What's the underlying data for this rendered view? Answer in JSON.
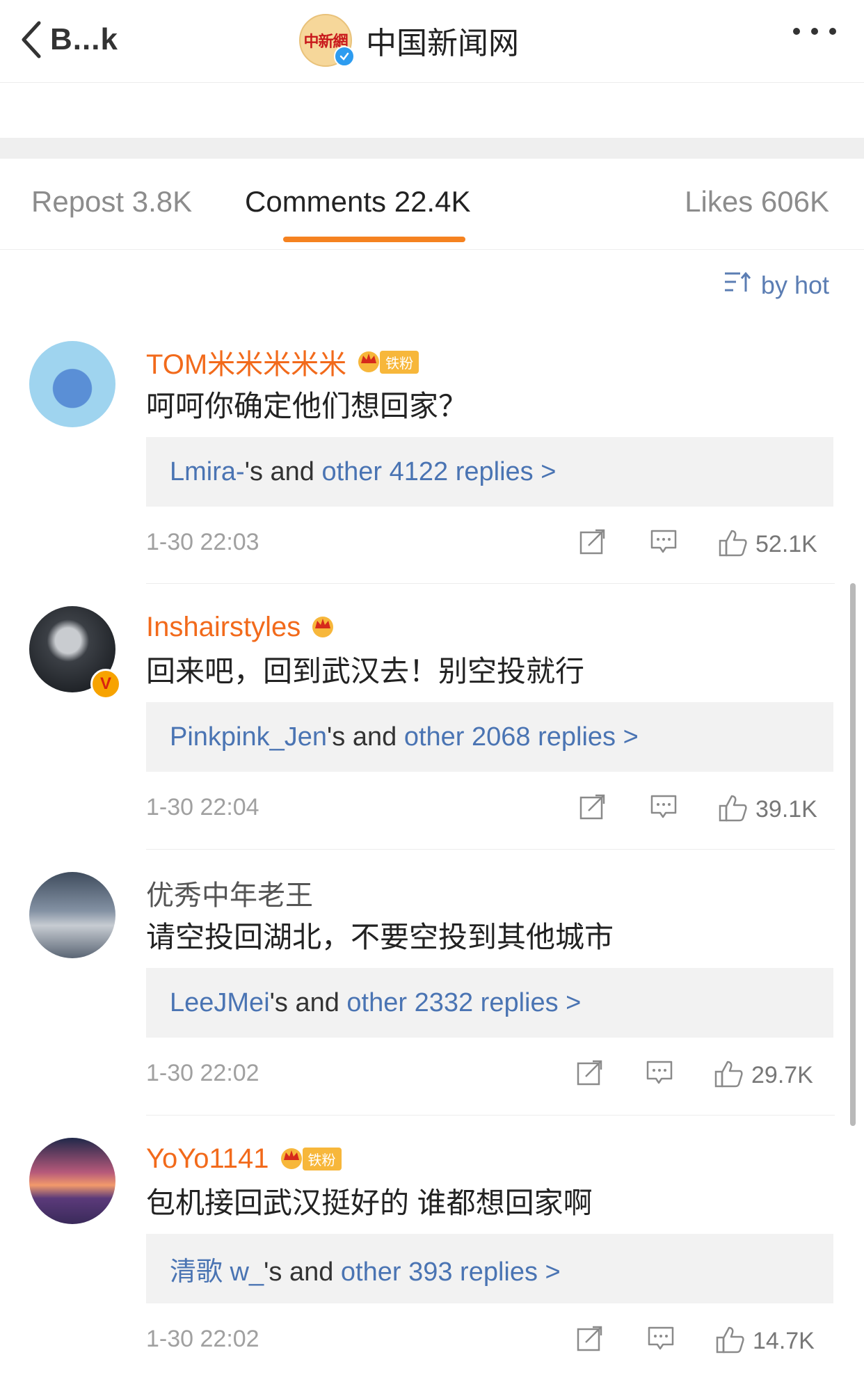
{
  "header": {
    "back_label": "B...k",
    "logo_text": "中新網",
    "title": "中国新闻网"
  },
  "tabs": [
    {
      "label": "Repost 3.8K"
    },
    {
      "label": "Comments 22.4K"
    },
    {
      "label": "Likes 606K"
    }
  ],
  "sort": {
    "label": "by hot"
  },
  "comments": [
    {
      "username": "TOM米米米米米",
      "fan_tag": "铁粉",
      "text": "呵呵你确定他们想回家？",
      "reply_user": "Lmira-",
      "reply_mid": "'s and ",
      "reply_link": "other 4122 replies >",
      "time": "1-30 22:03",
      "likes": "52.1K"
    },
    {
      "username": "Inshairstyles",
      "verified_badge": "V",
      "text": "回来吧，回到武汉去！别空投就行",
      "reply_user": "Pinkpink_Jen",
      "reply_mid": "'s and ",
      "reply_link": "other 2068 replies >",
      "time": "1-30 22:04",
      "likes": "39.1K"
    },
    {
      "username": "优秀中年老王",
      "text": "请空投回湖北，不要空投到其他城市",
      "reply_user": "LeeJMei",
      "reply_mid": "'s and ",
      "reply_link": "other 2332 replies >",
      "time": "1-30 22:02",
      "likes": "29.7K"
    },
    {
      "username": "YoYo1141",
      "fan_tag": "铁粉",
      "text": "包机接回武汉挺好的 谁都想回家啊",
      "reply_user": "清歌 w_",
      "reply_mid": "'s and ",
      "reply_link": "other 393 replies >",
      "time": "1-30 22:02",
      "likes": "14.7K"
    }
  ],
  "colors": {
    "accent": "#f58220",
    "username": "#f26a1b",
    "link": "#4a74b3",
    "reply_bg": "#f2f2f2"
  }
}
